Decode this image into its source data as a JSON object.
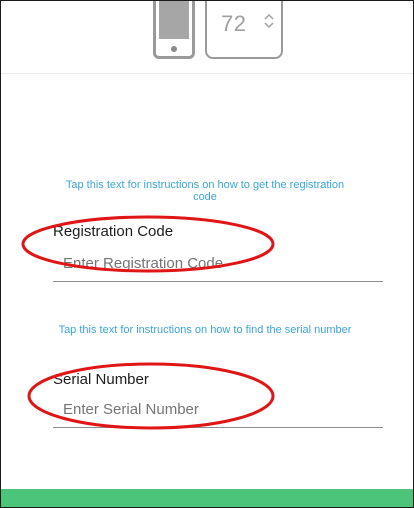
{
  "device": {
    "thermostat_temp": "72",
    "phone_icon": "phone-icon",
    "stepper_icon": "up-down-chevron-icon"
  },
  "registration": {
    "help_link": "Tap this text for instructions on how to get the registration code",
    "label": "Registration Code",
    "placeholder": "Enter Registration Code"
  },
  "serial": {
    "help_link": "Tap this text for instructions on how to find the serial number",
    "label": "Serial Number",
    "placeholder": "Enter Serial Number"
  },
  "colors": {
    "link": "#3da4d8",
    "annotation": "#e01616",
    "bottom_bar": "#4cc47a"
  }
}
